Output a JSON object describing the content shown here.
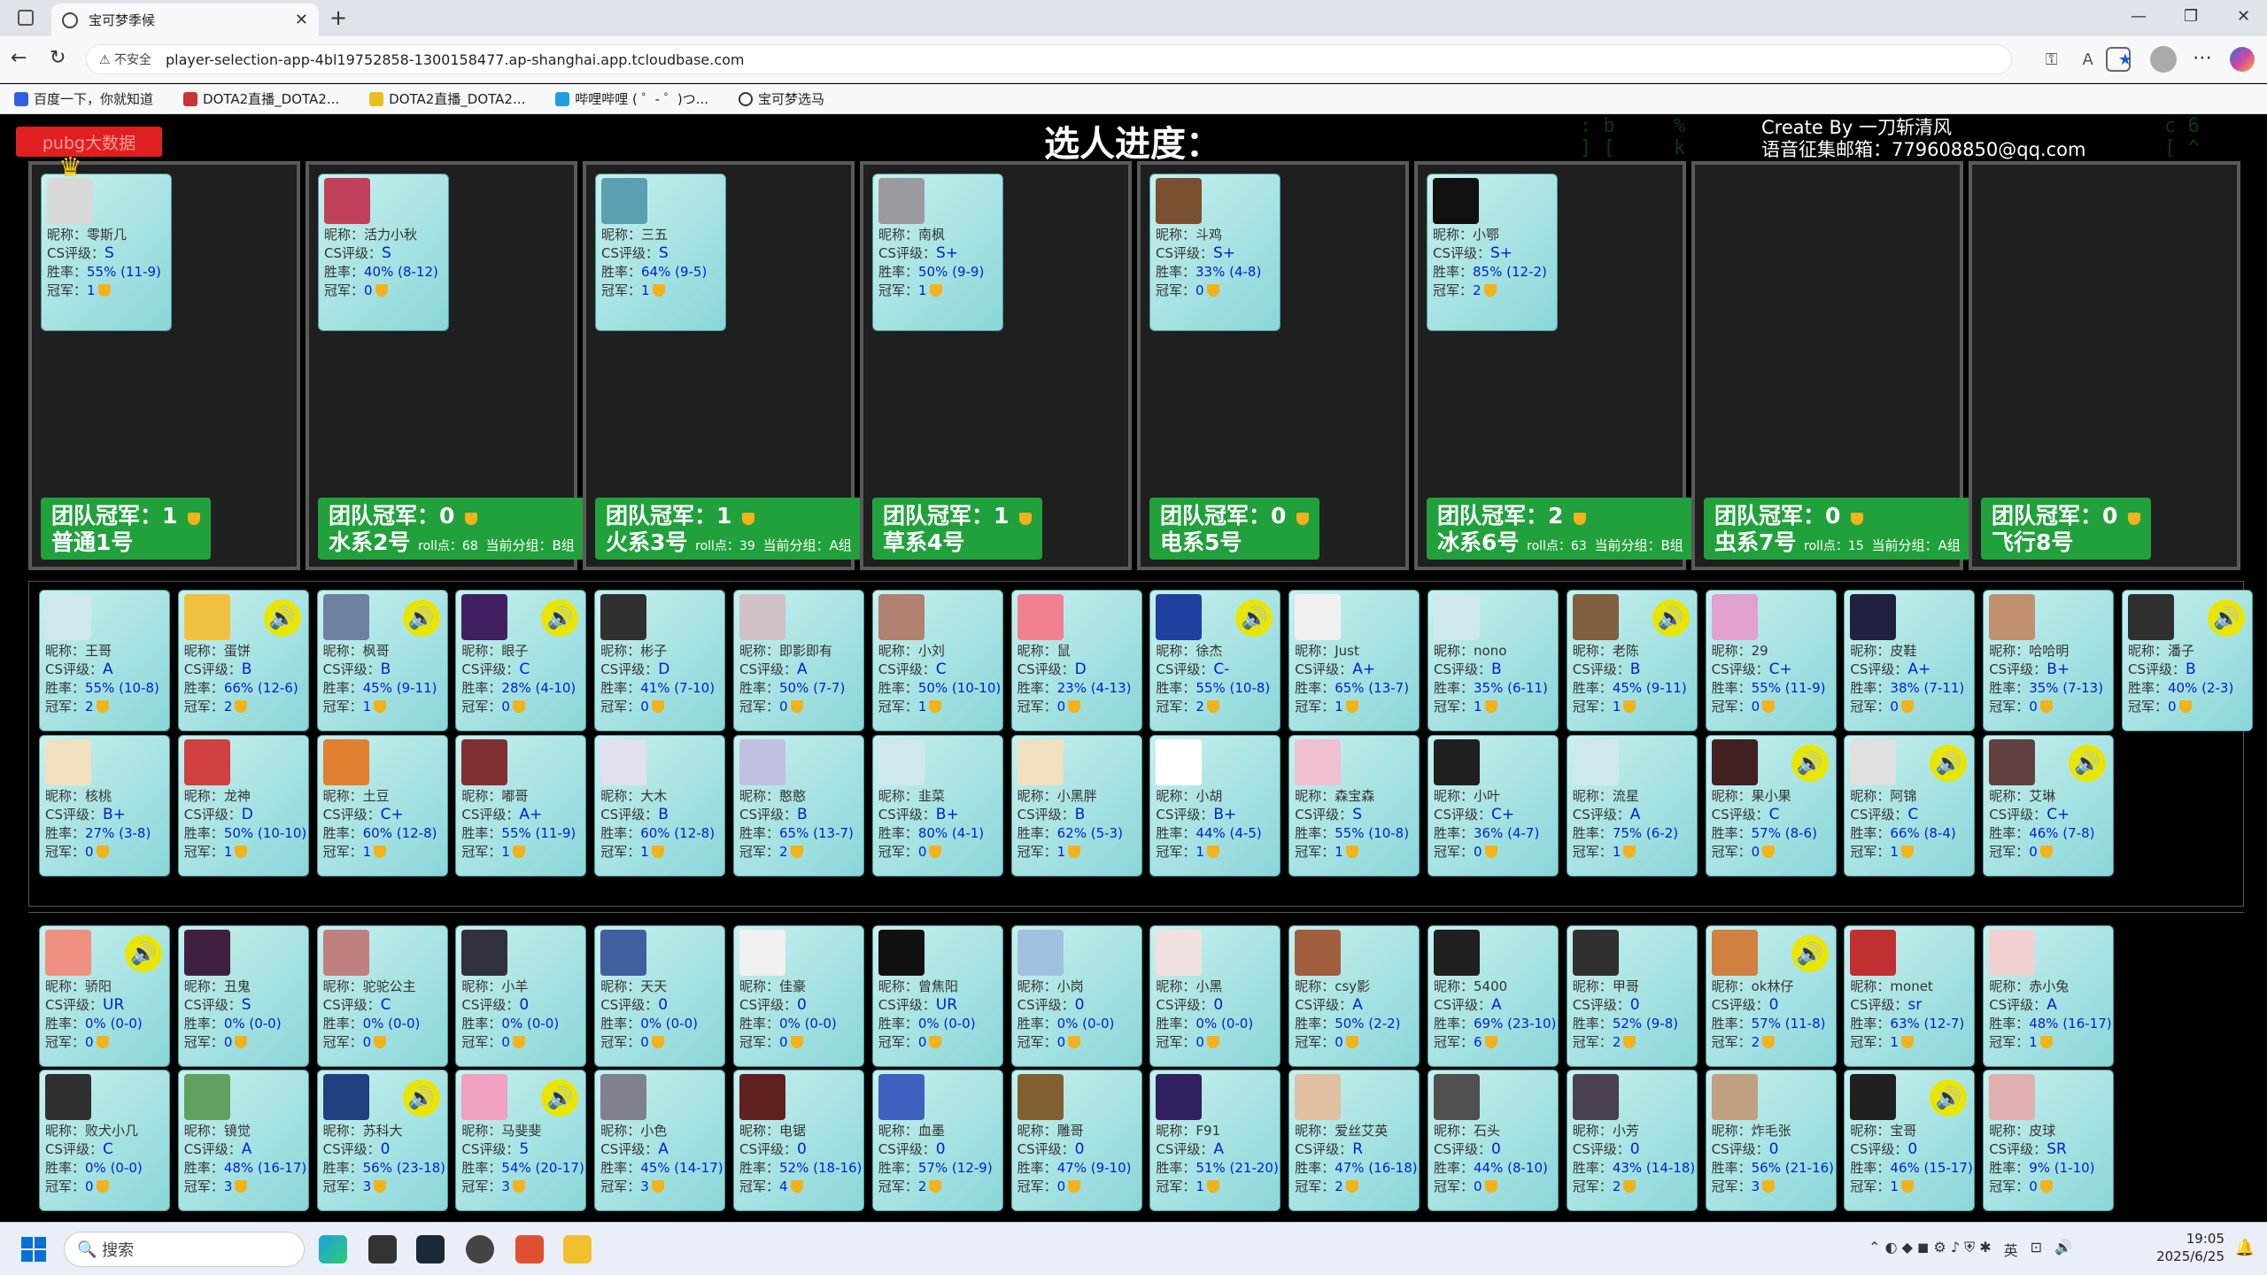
{
  "browser": {
    "tab_title": "宝可梦季候",
    "insecure": "不安全",
    "url": "player-selection-app-4bl19752858-1300158477.ap-shanghai.app.tcloudbase.com",
    "bookmarks": [
      "百度一下，你就知道",
      "DOTA2直播_DOTA2...",
      "DOTA2直播_DOTA2...",
      "哔哩哔哩 ( ゜- ゜)つ...",
      "宝可梦选马"
    ]
  },
  "page": {
    "pubg_label": "pubg大数据",
    "title": "选人进度：",
    "credit_line1": "Create By 一刀斩清风",
    "credit_line2": "语音征集邮箱：779608850@qq.com"
  },
  "labels": {
    "nick": "昵称：",
    "cs": "CS评级：",
    "win": "胜率：",
    "champ": "冠军："
  },
  "teams": [
    {
      "champ": "团队冠军：1",
      "name": "普通1号",
      "roll": "",
      "group": "",
      "member": {
        "nick": "零斯几",
        "cs": "S",
        "win": "55% (11-9)",
        "champ": "1",
        "color": "#d8d8d8"
      }
    },
    {
      "champ": "团队冠军：0",
      "name": "水系2号",
      "roll": "roll点：68",
      "group": "当前分组：B组",
      "member": {
        "nick": "活力小秋",
        "cs": "S",
        "win": "40% (8-12)",
        "champ": "0",
        "color": "#c0405a"
      }
    },
    {
      "champ": "团队冠军：1",
      "name": "火系3号",
      "roll": "roll点：39",
      "group": "当前分组：A组",
      "member": {
        "nick": "三五",
        "cs": "S",
        "win": "64% (9-5)",
        "champ": "1",
        "color": "#5aa0b0"
      }
    },
    {
      "champ": "团队冠军：1",
      "name": "草系4号",
      "roll": "",
      "group": "",
      "member": {
        "nick": "南枫",
        "cs": "S+",
        "win": "50% (9-9)",
        "champ": "1",
        "color": "#9a9aa0"
      }
    },
    {
      "champ": "团队冠军：0",
      "name": "电系5号",
      "roll": "",
      "group": "",
      "member": {
        "nick": "斗鸡",
        "cs": "S+",
        "win": "33% (4-8)",
        "champ": "0",
        "color": "#7a5030"
      }
    },
    {
      "champ": "团队冠军：2",
      "name": "冰系6号",
      "roll": "roll点：63",
      "group": "当前分组：B组",
      "member": {
        "nick": "小鄂",
        "cs": "S+",
        "win": "85% (12-2)",
        "champ": "2",
        "color": "#111"
      }
    },
    {
      "champ": "团队冠军：0",
      "name": "虫系7号",
      "roll": "roll点：15",
      "group": "当前分组：A组",
      "member": null
    },
    {
      "champ": "团队冠军：0",
      "name": "飞行8号",
      "roll": "",
      "group": "",
      "member": null
    }
  ],
  "pool_row1": [
    {
      "nick": "王哥",
      "cs": "A",
      "win": "55% (10-8)",
      "champ": "2",
      "color": "#cfe8f0"
    },
    {
      "nick": "蛋饼",
      "cs": "B",
      "win": "66% (12-6)",
      "champ": "2",
      "color": "#f2c040",
      "voice": true
    },
    {
      "nick": "枫哥",
      "cs": "B",
      "win": "45% (9-11)",
      "champ": "1",
      "color": "#7080a0",
      "voice": true
    },
    {
      "nick": "眼子",
      "cs": "C",
      "win": "28% (4-10)",
      "champ": "0",
      "color": "#402060",
      "voice": true
    },
    {
      "nick": "彬子",
      "cs": "D",
      "win": "41% (7-10)",
      "champ": "0",
      "color": "#303030"
    },
    {
      "nick": "即影即有",
      "cs": "A",
      "win": "50% (7-7)",
      "champ": "0",
      "color": "#d0c0c8"
    },
    {
      "nick": "小刘",
      "cs": "C",
      "win": "50% (10-10)",
      "champ": "1",
      "color": "#b08070"
    },
    {
      "nick": "鼠",
      "cs": "D",
      "win": "23% (4-13)",
      "champ": "0",
      "color": "#f08090"
    },
    {
      "nick": "徐杰",
      "cs": "C-",
      "win": "55% (10-8)",
      "champ": "2",
      "color": "#2040a0",
      "voice": true
    },
    {
      "nick": "Just",
      "cs": "A+",
      "win": "65% (13-7)",
      "champ": "1",
      "color": "#f0f0f0"
    },
    {
      "nick": "nono",
      "cs": "B",
      "win": "35% (6-11)",
      "champ": "1",
      "color": "#cfe8f0"
    },
    {
      "nick": "老陈",
      "cs": "B",
      "win": "45% (9-11)",
      "champ": "1",
      "color": "#806040",
      "voice": true
    },
    {
      "nick": "29",
      "cs": "C+",
      "win": "55% (11-9)",
      "champ": "0",
      "color": "#e0a0d0"
    },
    {
      "nick": "皮鞋",
      "cs": "A+",
      "win": "38% (7-11)",
      "champ": "0",
      "color": "#202040"
    },
    {
      "nick": "哈哈明",
      "cs": "B+",
      "win": "35% (7-13)",
      "champ": "0",
      "color": "#c09070"
    },
    {
      "nick": "潘子",
      "cs": "B",
      "win": "40% (2-3)",
      "champ": "0",
      "color": "#303030",
      "voice": true
    }
  ],
  "pool_row2": [
    {
      "nick": "核桃",
      "cs": "B+",
      "win": "27% (3-8)",
      "champ": "0",
      "color": "#f0e0c0"
    },
    {
      "nick": "龙神",
      "cs": "D",
      "win": "50% (10-10)",
      "champ": "1",
      "color": "#d04040"
    },
    {
      "nick": "土豆",
      "cs": "C+",
      "win": "60% (12-8)",
      "champ": "1",
      "color": "#e08030"
    },
    {
      "nick": "嘟哥",
      "cs": "A+",
      "win": "55% (11-9)",
      "champ": "1",
      "color": "#803030"
    },
    {
      "nick": "大木",
      "cs": "B",
      "win": "60% (12-8)",
      "champ": "1",
      "color": "#e0e0f0"
    },
    {
      "nick": "憨憨",
      "cs": "B",
      "win": "65% (13-7)",
      "champ": "2",
      "color": "#c0c0e0"
    },
    {
      "nick": "韭菜",
      "cs": "B+",
      "win": "80% (4-1)",
      "champ": "0",
      "color": "#cfe8f0"
    },
    {
      "nick": "小黑胖",
      "cs": "B",
      "win": "62% (5-3)",
      "champ": "1",
      "color": "#f0e0c0"
    },
    {
      "nick": "小胡",
      "cs": "B+",
      "win": "44% (4-5)",
      "champ": "1",
      "color": "#ffffff"
    },
    {
      "nick": "森宝森",
      "cs": "S",
      "win": "55% (10-8)",
      "champ": "1",
      "color": "#f0c0d0"
    },
    {
      "nick": "小叶",
      "cs": "C+",
      "win": "36% (4-7)",
      "champ": "0",
      "color": "#202020"
    },
    {
      "nick": "流星",
      "cs": "A",
      "win": "75% (6-2)",
      "champ": "1",
      "color": "#cfe8f0"
    },
    {
      "nick": "果小果",
      "cs": "C",
      "win": "57% (8-6)",
      "champ": "0",
      "color": "#402020",
      "voice": true
    },
    {
      "nick": "阿锦",
      "cs": "C",
      "win": "66% (8-4)",
      "champ": "1",
      "color": "#e0e0e0",
      "voice": true
    },
    {
      "nick": "艾琳",
      "cs": "C+",
      "win": "46% (7-8)",
      "champ": "0",
      "color": "#604040",
      "voice": true
    }
  ],
  "pool_row3": [
    {
      "nick": "骄阳",
      "cs": "UR",
      "win": "0% (0-0)",
      "champ": "0",
      "color": "#f09080",
      "voice": true
    },
    {
      "nick": "丑鬼",
      "cs": "S",
      "win": "0% (0-0)",
      "champ": "0",
      "color": "#402040"
    },
    {
      "nick": "驼驼公主",
      "cs": "C",
      "win": "0% (0-0)",
      "champ": "0",
      "color": "#c08080"
    },
    {
      "nick": "小羊",
      "cs": "0",
      "win": "0% (0-0)",
      "champ": "0",
      "color": "#303040"
    },
    {
      "nick": "天天",
      "cs": "0",
      "win": "0% (0-0)",
      "champ": "0",
      "color": "#4060a0"
    },
    {
      "nick": "佳豪",
      "cs": "0",
      "win": "0% (0-0)",
      "champ": "0",
      "color": "#f0f0f0"
    },
    {
      "nick": "曾焦阳",
      "cs": "UR",
      "win": "0% (0-0)",
      "champ": "0",
      "color": "#101010"
    },
    {
      "nick": "小岗",
      "cs": "0",
      "win": "0% (0-0)",
      "champ": "0",
      "color": "#a0c0e0"
    },
    {
      "nick": "小黑",
      "cs": "0",
      "win": "0% (0-0)",
      "champ": "0",
      "color": "#f0e0e0"
    },
    {
      "nick": "csy影",
      "cs": "A",
      "win": "50% (2-2)",
      "champ": "0",
      "color": "#a06040"
    },
    {
      "nick": "5400",
      "cs": "A",
      "win": "69% (23-10)",
      "champ": "6",
      "color": "#202020"
    },
    {
      "nick": "甲哥",
      "cs": "0",
      "win": "52% (9-8)",
      "champ": "2",
      "color": "#303030"
    },
    {
      "nick": "ok林仔",
      "cs": "0",
      "win": "57% (11-8)",
      "champ": "2",
      "color": "#d08040",
      "voice": true
    },
    {
      "nick": "monet",
      "cs": "sr",
      "win": "63% (12-7)",
      "champ": "1",
      "color": "#c03030"
    },
    {
      "nick": "赤小兔",
      "cs": "A",
      "win": "48% (16-17)",
      "champ": "1",
      "color": "#f0d0d0"
    }
  ],
  "pool_row4": [
    {
      "nick": "败犬小几",
      "cs": "C",
      "win": "0% (0-0)",
      "champ": "0",
      "color": "#303030"
    },
    {
      "nick": "镜觉",
      "cs": "A",
      "win": "48% (16-17)",
      "champ": "3",
      "color": "#60a060"
    },
    {
      "nick": "苏科大",
      "cs": "0",
      "win": "56% (23-18)",
      "champ": "3",
      "color": "#204080",
      "voice": true
    },
    {
      "nick": "马斐斐",
      "cs": "5",
      "win": "54% (20-17)",
      "champ": "3",
      "color": "#f0a0c0",
      "voice": true
    },
    {
      "nick": "小色",
      "cs": "A",
      "win": "45% (14-17)",
      "champ": "3",
      "color": "#808090"
    },
    {
      "nick": "电锯",
      "cs": "0",
      "win": "52% (18-16)",
      "champ": "4",
      "color": "#602020"
    },
    {
      "nick": "血墨",
      "cs": "0",
      "win": "57% (12-9)",
      "champ": "2",
      "color": "#4060c0"
    },
    {
      "nick": "雕哥",
      "cs": "0",
      "win": "47% (9-10)",
      "champ": "0",
      "color": "#806030"
    },
    {
      "nick": "F91",
      "cs": "A",
      "win": "51% (21-20)",
      "champ": "1",
      "color": "#302060"
    },
    {
      "nick": "爱丝艾英",
      "cs": "R",
      "win": "47% (16-18)",
      "champ": "2",
      "color": "#e0c0a0"
    },
    {
      "nick": "石头",
      "cs": "0",
      "win": "44% (8-10)",
      "champ": "0",
      "color": "#505050"
    },
    {
      "nick": "小芳",
      "cs": "0",
      "win": "43% (14-18)",
      "champ": "2",
      "color": "#4a4050"
    },
    {
      "nick": "炸毛张",
      "cs": "0",
      "win": "56% (21-16)",
      "champ": "3",
      "color": "#c0a080"
    },
    {
      "nick": "宝哥",
      "cs": "0",
      "win": "46% (15-17)",
      "champ": "1",
      "color": "#202020",
      "voice": true
    },
    {
      "nick": "皮球",
      "cs": "SR",
      "win": "9% (1-10)",
      "champ": "0",
      "color": "#e0b0b0"
    }
  ],
  "taskbar": {
    "search": "搜索",
    "time": "19:05",
    "date": "2025/6/25",
    "lang": "英"
  }
}
